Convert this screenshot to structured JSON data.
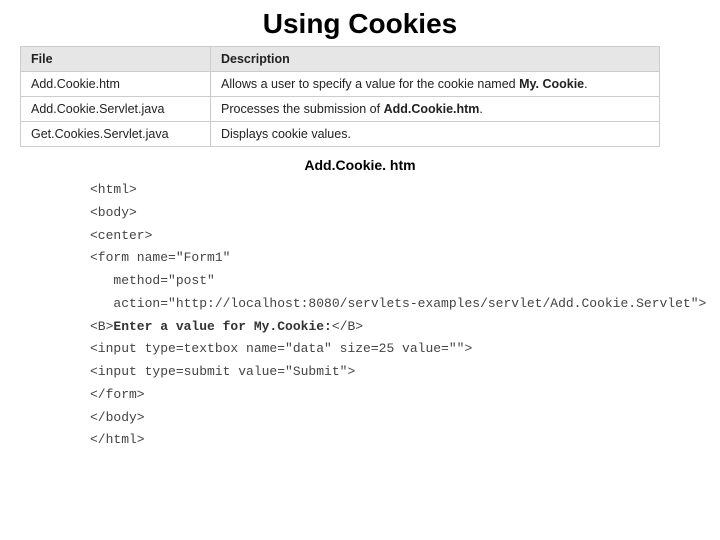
{
  "title": "Using Cookies",
  "table": {
    "headers": {
      "file": "File",
      "desc": "Description"
    },
    "rows": [
      {
        "file": "Add.Cookie.htm",
        "desc_pre": "Allows a user to specify a value for the cookie named ",
        "desc_bold": "My. Cookie",
        "desc_post": "."
      },
      {
        "file": "Add.Cookie.Servlet.java",
        "desc_pre": "Processes the submission of ",
        "desc_bold": "Add.Cookie.htm",
        "desc_post": "."
      },
      {
        "file": "Get.Cookies.Servlet.java",
        "desc_pre": "Displays cookie values.",
        "desc_bold": "",
        "desc_post": ""
      }
    ]
  },
  "caption": "Add.Cookie. htm",
  "code": {
    "l0": "<html>",
    "l1": "<body>",
    "l2": "<center>",
    "l3": "<form name=\"Form1\"",
    "l4": "   method=\"post\"",
    "l5": "   action=\"http://localhost:8080/servlets-examples/servlet/Add.Cookie.Servlet\">",
    "l6a": "<B>",
    "l6b": "Enter a value for My.Cookie:",
    "l6c": "</B>",
    "l7": "<input type=textbox name=\"data\" size=25 value=\"\">",
    "l8": "<input type=submit value=\"Submit\">",
    "l9": "</form>",
    "l10": "</body>",
    "l11": "</html>"
  }
}
